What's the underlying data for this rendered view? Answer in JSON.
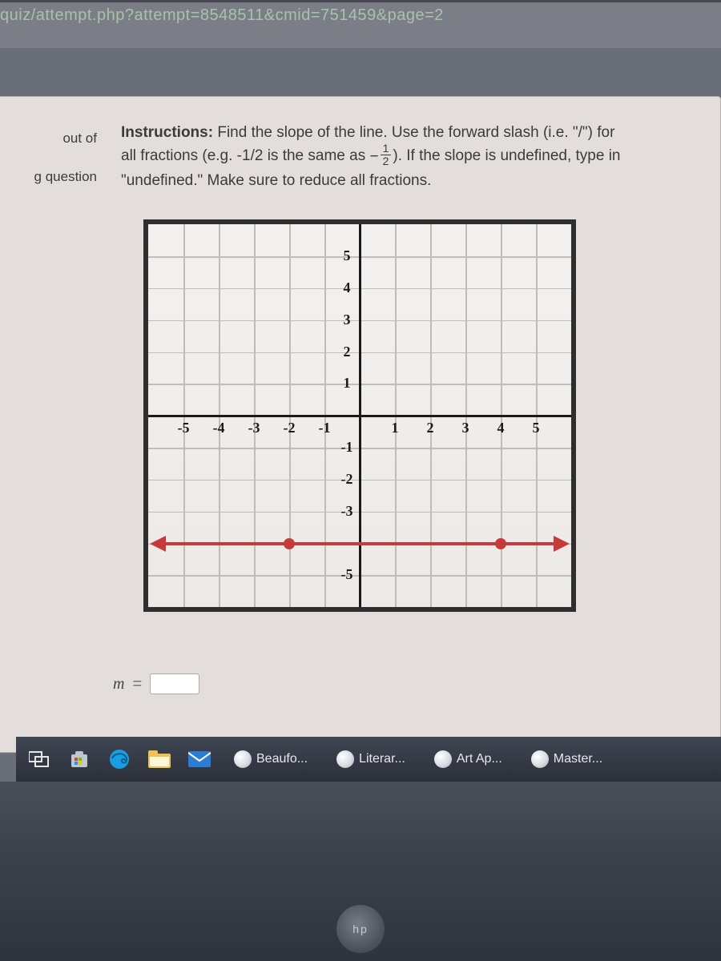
{
  "url": "quiz/attempt.php?attempt=8548511&cmid=751459&page=2",
  "sidebar": {
    "out_of": "out of",
    "flag": "g question"
  },
  "instructions": {
    "label": "Instructions:",
    "text1": "Find the slope of the line. Use the forward slash (i.e. \"/\") for all fractions (e.g. -1/2 is the same as ",
    "frac_num": "1",
    "frac_den": "2",
    "text2": "). If the slope is undefined, type in \"undefined.\" Make sure to reduce all fractions."
  },
  "chart_data": {
    "type": "line",
    "xlabel": "",
    "ylabel": "",
    "xlim": [
      -6,
      6
    ],
    "ylim": [
      -6,
      6
    ],
    "x_ticks": [
      -5,
      -4,
      -3,
      -2,
      -1,
      1,
      2,
      3,
      4,
      5
    ],
    "y_ticks": [
      5,
      4,
      3,
      2,
      1,
      -1,
      -2,
      -3,
      -5
    ],
    "series": [
      {
        "name": "line",
        "y_constant": -4,
        "points": [
          {
            "x": -2,
            "y": -4
          },
          {
            "x": 4,
            "y": -4
          }
        ]
      }
    ]
  },
  "answer": {
    "var": "m",
    "eq": "=",
    "value": ""
  },
  "taskbar": {
    "items": [
      {
        "label": "Beaufo..."
      },
      {
        "label": "Literar..."
      },
      {
        "label": "Art Ap..."
      },
      {
        "label": "Master..."
      }
    ]
  },
  "logo": "hp"
}
